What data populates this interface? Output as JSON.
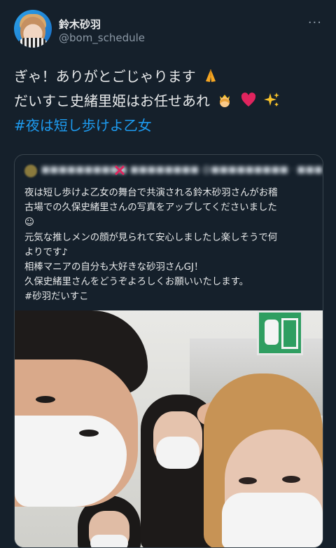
{
  "user": {
    "display_name": "鈴木砂羽",
    "handle": "@bom_schedule"
  },
  "more_icon_label": "···",
  "tweet": {
    "line1": "ぎゃ！ありがとごじゃります",
    "line2": "だいすこ史緒里姫はお任せあれ",
    "hashtag": "#夜は短し歩けよ乙女",
    "emojis": [
      "folded-hands-icon",
      "princess-icon",
      "red-heart-icon",
      "sparkles-icon"
    ]
  },
  "quote": {
    "author_blurred": "■■■■■■■■■■ ■■■■■■■■ @■■■■■■■■■ · ■■■",
    "text_lines": [
      "夜は短し歩けよ乙女の舞台で共演される鈴木砂羽さんがお稽",
      "古場での久保史緒里さんの写真をアップしてくださいました",
      "☺",
      "元気な推しメンの顔が見られて安心しましたし楽しそうで何",
      "よりです♪",
      "相棒マニアの自分も大好きな砂羽さんGJ！",
      "久保史緒里さんをどうぞよろしくお願いいたします。",
      "#砂羽だいすこ"
    ]
  },
  "colors": {
    "background": "#15202b",
    "text": "#e7e9ea",
    "secondary": "#8b98a5",
    "link": "#1d9bf0",
    "border": "#38444d"
  }
}
